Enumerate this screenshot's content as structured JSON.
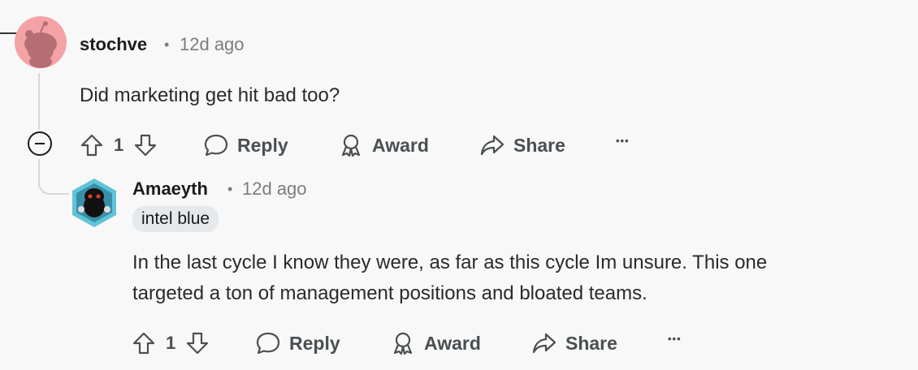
{
  "comment1": {
    "author": "stochve",
    "separator": "•",
    "time": "12d ago",
    "body": "Did marketing get hit bad too?",
    "votes": "1",
    "reply_label": "Reply",
    "award_label": "Award",
    "share_label": "Share",
    "more_label": "•••"
  },
  "comment2": {
    "author": "Amaeyth",
    "separator": "•",
    "time": "12d ago",
    "flair": "intel blue",
    "body_line1": "In the last cycle I know they were, as far as this cycle Im unsure. This one",
    "body_line2": "targeted a ton of management positions and bloated teams.",
    "votes": "1",
    "reply_label": "Reply",
    "award_label": "Award",
    "share_label": "Share",
    "more_label": "•••"
  },
  "colors": {
    "background": "#f8f8f8",
    "avatar1_bg": "#f4a2a6",
    "flair_bg": "#e5e9ec",
    "action_text": "#4a4f52"
  }
}
